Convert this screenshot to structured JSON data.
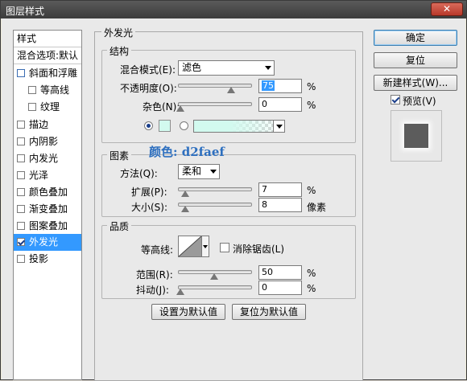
{
  "window": {
    "title": "图层样式",
    "close_glyph": "✕"
  },
  "left_list": {
    "header_styles": "样式",
    "header_blending": "混合选项:默认",
    "items": [
      {
        "label": "斜面和浮雕",
        "checked": false
      },
      {
        "label": "等高线",
        "checked": false,
        "indent": true
      },
      {
        "label": "纹理",
        "checked": false,
        "indent": true
      },
      {
        "label": "描边",
        "checked": false
      },
      {
        "label": "内阴影",
        "checked": false
      },
      {
        "label": "内发光",
        "checked": false
      },
      {
        "label": "光泽",
        "checked": false
      },
      {
        "label": "颜色叠加",
        "checked": false
      },
      {
        "label": "渐变叠加",
        "checked": false
      },
      {
        "label": "图案叠加",
        "checked": false
      },
      {
        "label": "外发光",
        "checked": true,
        "selected": true
      },
      {
        "label": "投影",
        "checked": false
      }
    ]
  },
  "panel": {
    "title": "外发光",
    "structure": {
      "title": "结构",
      "blend_mode_label": "混合模式(E):",
      "blend_mode_value": "滤色",
      "opacity_label": "不透明度(O):",
      "opacity_value": "75",
      "opacity_fraction": 0.75,
      "noise_label": "杂色(N):",
      "noise_value": "0",
      "noise_fraction": 0,
      "percent": "%"
    },
    "elements": {
      "title": "图素",
      "technique_label": "方法(Q):",
      "technique_value": "柔和",
      "spread_label": "扩展(P):",
      "spread_value": "7",
      "spread_fraction": 0.07,
      "size_label": "大小(S):",
      "size_value": "8",
      "size_unit": "像素",
      "percent": "%"
    },
    "quality": {
      "title": "品质",
      "contour_label": "等高线:",
      "anti_alias_label": "消除锯齿(L)",
      "range_label": "范围(R):",
      "range_value": "50",
      "range_fraction": 0.5,
      "jitter_label": "抖动(J):",
      "jitter_value": "0",
      "jitter_fraction": 0,
      "percent": "%"
    },
    "annotation": "颜色: d2faef",
    "glow_color": "#d2faef",
    "make_default_button": "设置为默认值",
    "reset_default_button": "复位为默认值"
  },
  "right": {
    "ok_button": "确定",
    "reset_button": "复位",
    "new_style_button": "新建样式(W)...",
    "preview_label": "预览(V)",
    "preview_checked": true
  }
}
